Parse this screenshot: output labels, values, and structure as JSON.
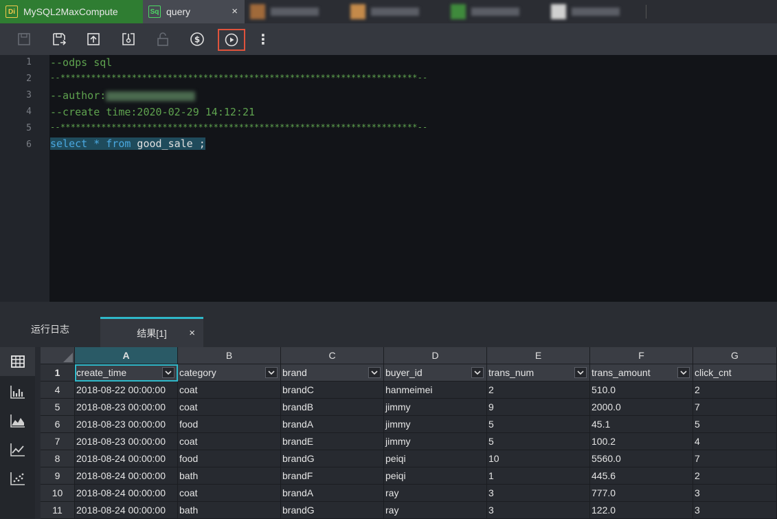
{
  "tabs": [
    {
      "badge": "Di",
      "label": "MySQL2MaxCompute"
    },
    {
      "badge": "Sq",
      "label": "query",
      "close": "×"
    }
  ],
  "blurred_tabs": [
    {
      "swatch": "#a06a3a"
    },
    {
      "swatch": "#c48a4a"
    },
    {
      "swatch": "#3f8a3c"
    },
    {
      "swatch": "#d0d0d0"
    }
  ],
  "toolbar": {
    "icons": [
      "save-icon",
      "save-as-icon",
      "commit-icon",
      "deploy-icon",
      "lock-icon",
      "cost-icon",
      "run-icon",
      "more-icon"
    ],
    "more_glyph": "⋮"
  },
  "editor": {
    "line_numbers": [
      "1",
      "2",
      "3",
      "4",
      "5",
      "6"
    ],
    "line1": "--odps sql",
    "line2": "--**********************************************************************--",
    "line3": "--author:",
    "line4": "--create time:2020-02-29 14:12:21",
    "line5": "--**********************************************************************--",
    "line6_kw1": "select",
    "line6_star": " * ",
    "line6_kw2": "from",
    "line6_rest": " good_sale ;"
  },
  "panel": {
    "log_tab": "运行日志",
    "result_tab": "结果[1]",
    "close": "×"
  },
  "sidebar_icons": [
    "table-icon",
    "bar-chart-icon",
    "area-chart-icon",
    "line-chart-icon",
    "scatter-chart-icon"
  ],
  "grid": {
    "col_letters": [
      "A",
      "B",
      "C",
      "D",
      "E",
      "F",
      "G"
    ],
    "header_row_num": "1",
    "columns": [
      "create_time",
      "category",
      "brand",
      "buyer_id",
      "trans_num",
      "trans_amount",
      "click_cnt"
    ],
    "dropdown_glyph": "⌄",
    "rows": [
      {
        "n": "4",
        "cells": [
          "2018-08-22 00:00:00",
          "coat",
          "brandC",
          "hanmeimei",
          "2",
          "510.0",
          "2"
        ]
      },
      {
        "n": "5",
        "cells": [
          "2018-08-23 00:00:00",
          "coat",
          "brandB",
          "jimmy",
          "9",
          "2000.0",
          "7"
        ]
      },
      {
        "n": "6",
        "cells": [
          "2018-08-23 00:00:00",
          "food",
          "brandA",
          "jimmy",
          "5",
          "45.1",
          "5"
        ]
      },
      {
        "n": "7",
        "cells": [
          "2018-08-23 00:00:00",
          "coat",
          "brandE",
          "jimmy",
          "5",
          "100.2",
          "4"
        ]
      },
      {
        "n": "8",
        "cells": [
          "2018-08-24 00:00:00",
          "food",
          "brandG",
          "peiqi",
          "10",
          "5560.0",
          "7"
        ]
      },
      {
        "n": "9",
        "cells": [
          "2018-08-24 00:00:00",
          "bath",
          "brandF",
          "peiqi",
          "1",
          "445.6",
          "2"
        ]
      },
      {
        "n": "10",
        "cells": [
          "2018-08-24 00:00:00",
          "coat",
          "brandA",
          "ray",
          "3",
          "777.0",
          "3"
        ]
      },
      {
        "n": "11",
        "cells": [
          "2018-08-24 00:00:00",
          "bath",
          "brandG",
          "ray",
          "3",
          "122.0",
          "3"
        ]
      }
    ]
  },
  "colors": {
    "tab_active_green": "#2f7d32",
    "accent_teal": "#2fb8c9",
    "run_highlight": "#e0533c",
    "comment_green": "#5fa34f",
    "keyword_blue": "#4aa8e0"
  }
}
